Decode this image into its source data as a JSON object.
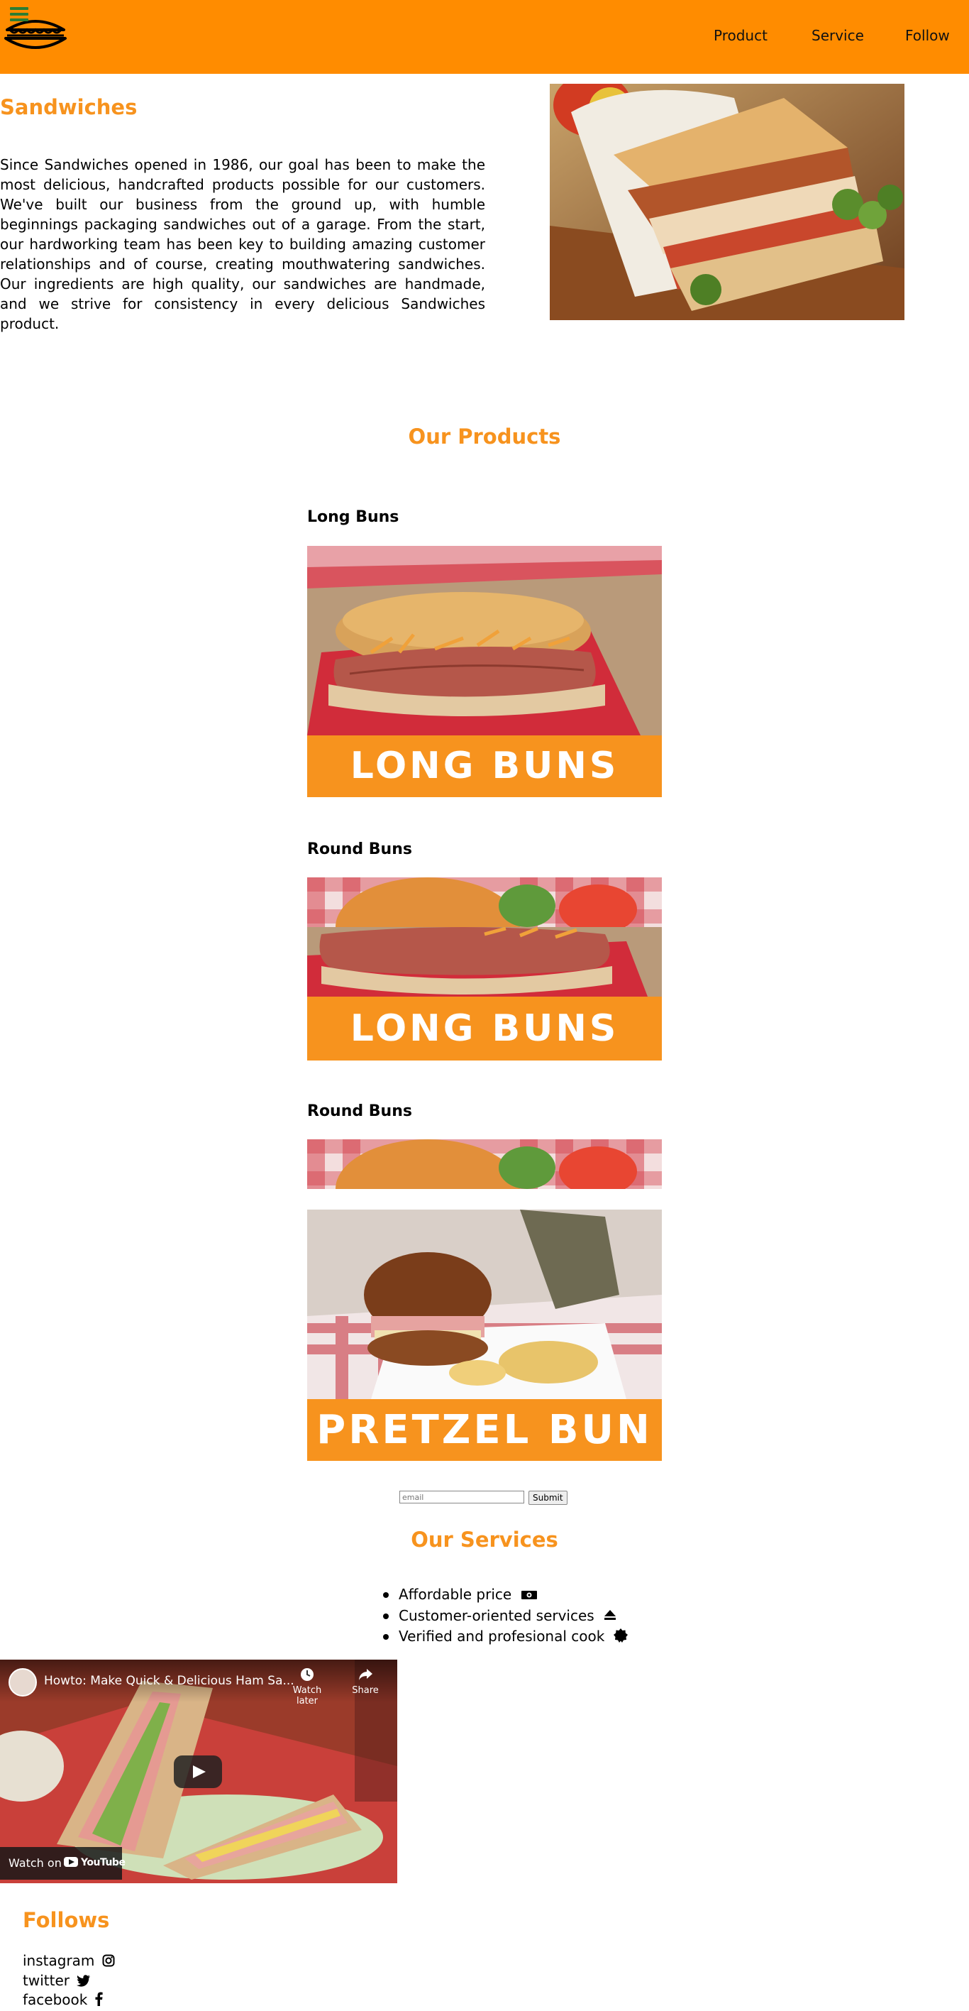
{
  "header": {
    "nav": [
      "Product",
      "Service",
      "Follow"
    ],
    "brand_color": "#ff8c00",
    "menu_icon": "hamburger-icon",
    "logo_icon": "sandwich-logo-icon"
  },
  "about": {
    "title": "Sandwiches",
    "text": "Since Sandwiches opened in 1986, our goal has been to make the most delicious, handcrafted products possible for our customers. We've built our business from the ground up, with humble beginnings packaging sandwiches out of a garage. From the start, our hardworking team has been key to building amazing customer relationships and of course, creating mouthwatering sandwiches. Our ingredients are high quality, our sandwiches are handmade, and we strive for consistency in every delicious Sandwiches product."
  },
  "products": {
    "title": "Our Products",
    "items": [
      {
        "name": "Long Buns",
        "banner": "LONG BUNS"
      },
      {
        "name": "Round Buns",
        "banner": "LONG BUNS"
      },
      {
        "name": "Round Buns",
        "banner": "PRETZEL BUN"
      }
    ]
  },
  "form": {
    "email_placeholder": "email",
    "submit_label": "Submit"
  },
  "services": {
    "title": "Our Services",
    "items": [
      {
        "label": "Affordable price",
        "icon": "money-icon"
      },
      {
        "label": "Customer-oriented services",
        "icon": "eject-icon"
      },
      {
        "label": "Verified and profesional cook",
        "icon": "badge-icon"
      }
    ]
  },
  "video": {
    "title": "Howto: Make Quick & Delicious Ham Sa...",
    "watch_later": "Watch later",
    "share": "Share",
    "watch_on": "Watch on",
    "youtube": "YouTube"
  },
  "follows": {
    "title": "Follows",
    "links": [
      {
        "label": "instagram",
        "icon": "instagram-icon"
      },
      {
        "label": "twitter",
        "icon": "twitter-icon"
      },
      {
        "label": "facebook",
        "icon": "facebook-icon"
      }
    ]
  },
  "accent_color": "#f7931e"
}
